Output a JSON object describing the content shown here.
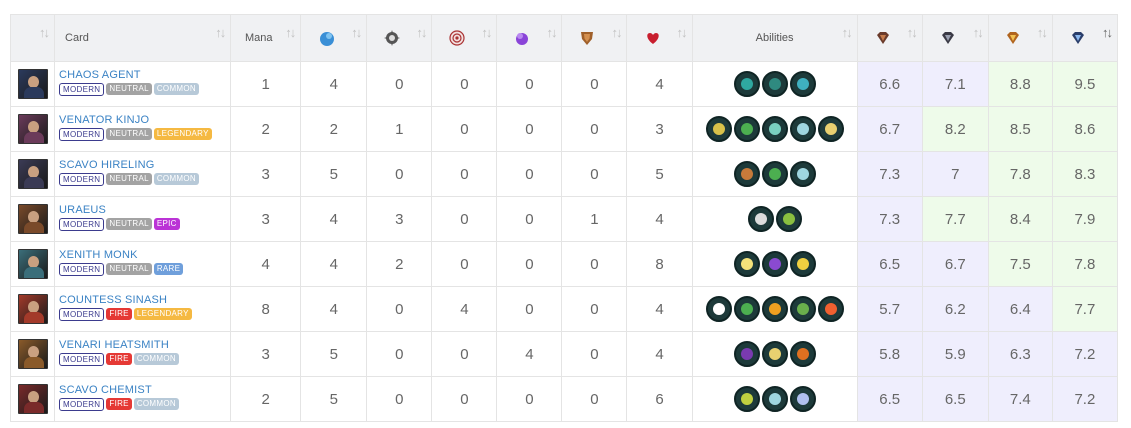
{
  "headers": {
    "card": "Card",
    "mana": "Mana",
    "abilities": "Abilities",
    "sort_icon": "↑↓",
    "sort_active_icon": "↑↓"
  },
  "header_icons": [
    "water-drop-icon",
    "gear-icon",
    "target-icon",
    "magic-orb-icon",
    "shield-icon",
    "heart-icon",
    "bronze-gem-icon",
    "silver-gem-icon",
    "gold-gem-icon",
    "diamond-gem-icon"
  ],
  "rows": [
    {
      "name": "CHAOS AGENT",
      "format": "MODERN",
      "element": "NEUTRAL",
      "element_class": "neutral",
      "rarity": "COMMON",
      "rarity_class": "common",
      "mana": "1",
      "stats": [
        "4",
        "0",
        "0",
        "0",
        "0",
        "4"
      ],
      "abilities": [
        "slash",
        "slash-dark",
        "dodge"
      ],
      "scores": [
        "6.6",
        "7.1",
        "8.8",
        "9.5"
      ],
      "score_bg": [
        "purple",
        "purple",
        "green",
        "green"
      ],
      "thumb_color": "#2b3a5c"
    },
    {
      "name": "VENATOR KINJO",
      "format": "MODERN",
      "element": "NEUTRAL",
      "element_class": "neutral",
      "rarity": "LEGENDARY",
      "rarity_class": "legendary",
      "mana": "2",
      "stats": [
        "2",
        "1",
        "0",
        "0",
        "0",
        "3"
      ],
      "abilities": [
        "star",
        "crown",
        "ghost",
        "swirl",
        "diamond"
      ],
      "scores": [
        "6.7",
        "8.2",
        "8.5",
        "8.6"
      ],
      "score_bg": [
        "purple",
        "green",
        "green",
        "green"
      ],
      "thumb_color": "#6b3b5a"
    },
    {
      "name": "SCAVO HIRELING",
      "format": "MODERN",
      "element": "NEUTRAL",
      "element_class": "neutral",
      "rarity": "COMMON",
      "rarity_class": "common",
      "mana": "3",
      "stats": [
        "5",
        "0",
        "0",
        "0",
        "0",
        "5"
      ],
      "abilities": [
        "hammer",
        "crown",
        "swirl"
      ],
      "scores": [
        "7.3",
        "7",
        "7.8",
        "8.3"
      ],
      "score_bg": [
        "purple",
        "purple",
        "green",
        "green"
      ],
      "thumb_color": "#3b3b55"
    },
    {
      "name": "URAEUS",
      "format": "MODERN",
      "element": "NEUTRAL",
      "element_class": "neutral",
      "rarity": "EPIC",
      "rarity_class": "epic",
      "mana": "3",
      "stats": [
        "4",
        "3",
        "0",
        "0",
        "1",
        "4"
      ],
      "abilities": [
        "mask",
        "bird"
      ],
      "scores": [
        "7.3",
        "7.7",
        "8.4",
        "7.9"
      ],
      "score_bg": [
        "purple",
        "green",
        "green",
        "green"
      ],
      "thumb_color": "#7a4a2a"
    },
    {
      "name": "XENITH MONK",
      "format": "MODERN",
      "element": "NEUTRAL",
      "element_class": "neutral",
      "rarity": "RARE",
      "rarity_class": "rare",
      "mana": "4",
      "stats": [
        "4",
        "2",
        "0",
        "0",
        "0",
        "8"
      ],
      "abilities": [
        "spark",
        "void",
        "leaf"
      ],
      "scores": [
        "6.5",
        "6.7",
        "7.5",
        "7.8"
      ],
      "score_bg": [
        "purple",
        "purple",
        "green",
        "green"
      ],
      "thumb_color": "#3b6e7a"
    },
    {
      "name": "COUNTESS SINASH",
      "format": "MODERN",
      "element": "FIRE",
      "element_class": "fire",
      "rarity": "LEGENDARY",
      "rarity_class": "legendary",
      "mana": "8",
      "stats": [
        "4",
        "0",
        "4",
        "0",
        "0",
        "4"
      ],
      "abilities": [
        "eye",
        "crown",
        "bolt",
        "skull",
        "burst"
      ],
      "scores": [
        "5.7",
        "6.2",
        "6.4",
        "7.7"
      ],
      "score_bg": [
        "purple",
        "purple",
        "purple",
        "green"
      ],
      "thumb_color": "#a33a2a"
    },
    {
      "name": "VENARI HEATSMITH",
      "format": "MODERN",
      "element": "FIRE",
      "element_class": "fire",
      "rarity": "COMMON",
      "rarity_class": "common",
      "mana": "3",
      "stats": [
        "5",
        "0",
        "0",
        "4",
        "0",
        "4"
      ],
      "abilities": [
        "shield",
        "diamond",
        "rope"
      ],
      "scores": [
        "5.8",
        "5.9",
        "6.3",
        "7.2"
      ],
      "score_bg": [
        "purple",
        "purple",
        "purple",
        "purple"
      ],
      "thumb_color": "#8a5a2a"
    },
    {
      "name": "SCAVO CHEMIST",
      "format": "MODERN",
      "element": "FIRE",
      "element_class": "fire",
      "rarity": "COMMON",
      "rarity_class": "common",
      "mana": "2",
      "stats": [
        "5",
        "0",
        "0",
        "0",
        "0",
        "6"
      ],
      "abilities": [
        "flask",
        "swirl",
        "wind"
      ],
      "scores": [
        "6.5",
        "6.5",
        "7.4",
        "7.2"
      ],
      "score_bg": [
        "purple",
        "purple",
        "purple",
        "purple"
      ],
      "thumb_color": "#7a2a2a"
    }
  ],
  "ability_colors": {
    "slash": "#2fa8a0",
    "slash-dark": "#2f8a80",
    "dodge": "#3fb0c0",
    "star": "#d9c24a",
    "crown": "#4caf50",
    "ghost": "#7ad0c0",
    "swirl": "#9fd6e0",
    "diamond": "#e8d070",
    "hammer": "#c77a3a",
    "mask": "#dddddd",
    "bird": "#8abf40",
    "spark": "#f4e27a",
    "void": "#8a4ad0",
    "leaf": "#f0d040",
    "eye": "#ffffff",
    "bolt": "#f0a020",
    "skull": "#6ab04c",
    "burst": "#f06030",
    "shield": "#7a3ab0",
    "rope": "#e07020",
    "flask": "#c0d040",
    "wind": "#b0c0f0"
  },
  "colors": {
    "name_link": "#3a82c4",
    "purple_bg": "#efeefd",
    "green_bg": "#eefbea"
  }
}
